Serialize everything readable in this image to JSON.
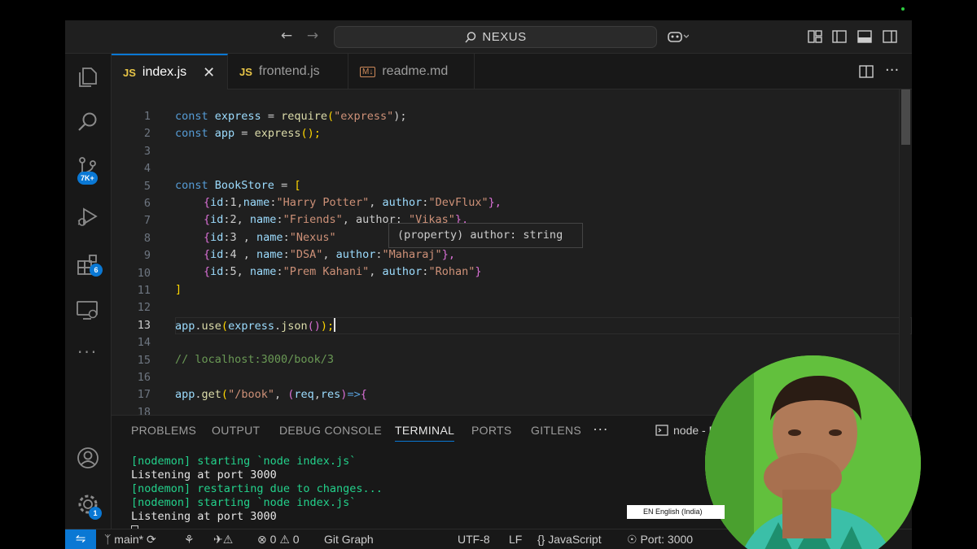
{
  "titlebar": {
    "search_text": "NEXUS",
    "back_icon": "arrow-left-icon",
    "forward_icon": "arrow-right-icon",
    "copilot_icon": "copilot-icon",
    "layout_icons": [
      "customize-layout-icon",
      "toggle-sidebar-icon",
      "toggle-panel-icon",
      "toggle-secondary-sidebar-icon"
    ]
  },
  "activity_bar": {
    "items": [
      {
        "name": "explorer",
        "icon": "files-icon"
      },
      {
        "name": "search",
        "icon": "search-icon"
      },
      {
        "name": "source-control",
        "icon": "source-control-icon",
        "badge": "7K+"
      },
      {
        "name": "run-debug",
        "icon": "debug-icon"
      },
      {
        "name": "extensions",
        "icon": "extensions-icon",
        "badge": "6"
      },
      {
        "name": "remote-explorer",
        "icon": "remote-explorer-icon"
      },
      {
        "name": "more",
        "icon": "ellipsis-icon"
      }
    ],
    "bottom": [
      {
        "name": "accounts",
        "icon": "account-icon"
      },
      {
        "name": "manage",
        "icon": "gear-icon",
        "badge": "1"
      }
    ]
  },
  "tabs": [
    {
      "badge": "JS",
      "label": "index.js",
      "active": true
    },
    {
      "badge": "JS",
      "label": "frontend.js",
      "active": false
    },
    {
      "badge": "M↓",
      "label": "readme.md",
      "active": false
    }
  ],
  "editor": {
    "line_numbers": [
      "1",
      "2",
      "3",
      "4",
      "5",
      "6",
      "7",
      "8",
      "9",
      "10",
      "11",
      "12",
      "13",
      "14",
      "15",
      "16",
      "17",
      "18"
    ],
    "current_line": 13,
    "tooltip": "(property) author: string",
    "lines": {
      "l1": {
        "a": "const ",
        "b": "express",
        "c": " = ",
        "d": "require",
        "e": "(",
        "f": "\"express\"",
        "g": ");"
      },
      "l2": {
        "a": "const ",
        "b": "app",
        "c": " = ",
        "d": "express",
        "e": "();"
      },
      "l5": {
        "a": "const ",
        "b": "BookStore",
        "c": " = ",
        "d": "["
      },
      "l6": {
        "a": "{",
        "b": "id",
        "c": ":1,",
        "d": "name",
        "e": ":",
        "f": "\"Harry Potter\"",
        "g": ", ",
        "h": "author",
        "i": ":",
        "j": "\"DevFlux\"",
        "k": "},"
      },
      "l7": {
        "a": "{",
        "b": "id",
        "c": ":2, ",
        "d": "name",
        "e": ":",
        "f": "\"Friends\"",
        "g": ", author: ",
        "h": "\"Vikas\"",
        "i": "},"
      },
      "l8": {
        "a": "{",
        "b": "id",
        "c": ":3 , ",
        "d": "name",
        "e": ":",
        "f": "\"Nexus\""
      },
      "l9": {
        "a": "{",
        "b": "id",
        "c": ":4 , ",
        "d": "name",
        "e": ":",
        "f": "\"DSA\"",
        "g": ", ",
        "h": "author",
        "i": ":",
        "j": "\"Maharaj\"",
        "k": "},"
      },
      "l10": {
        "a": "{",
        "b": "id",
        "c": ":5, ",
        "d": "name",
        "e": ":",
        "f": "\"Prem Kahani\"",
        "g": ", ",
        "h": "author",
        "i": ":",
        "j": "\"Rohan\"",
        "k": "}"
      },
      "l11": {
        "a": "]"
      },
      "l13": {
        "a": "app",
        "b": ".",
        "c": "use",
        "d": "(",
        "e": "express",
        "f": ".",
        "g": "json",
        "h": "()",
        "i": ");"
      },
      "l15": {
        "a": "// localhost:3000/book/3"
      },
      "l17": {
        "a": "app",
        "b": ".",
        "c": "get",
        "d": "(",
        "e": "\"/book\"",
        "f": ", ",
        "g": "(",
        "h": "req",
        "i": ",",
        "j": "res",
        "k": ")",
        "l": "=>",
        "m": "{"
      }
    }
  },
  "panel": {
    "tabs": [
      "PROBLEMS",
      "OUTPUT",
      "DEBUG CONSOLE",
      "TERMINAL",
      "PORTS",
      "GITLENS"
    ],
    "active_tab": "TERMINAL",
    "more": "···",
    "terminal_name": "node - D",
    "terminal_lines": [
      "[nodemon] starting `node index.js`",
      "Listening at port 3000",
      "[nodemon] restarting due to changes...",
      "[nodemon] starting `node index.js`",
      "Listening at port 3000"
    ]
  },
  "statusbar": {
    "branch": "main*",
    "errors": "0",
    "warnings": "0",
    "git_graph": "Git Graph",
    "encoding": "UTF-8",
    "eol": "LF",
    "language": "JavaScript",
    "port": "Port: 3000"
  },
  "overlay": {
    "language_indicator": "EN English (India)"
  }
}
